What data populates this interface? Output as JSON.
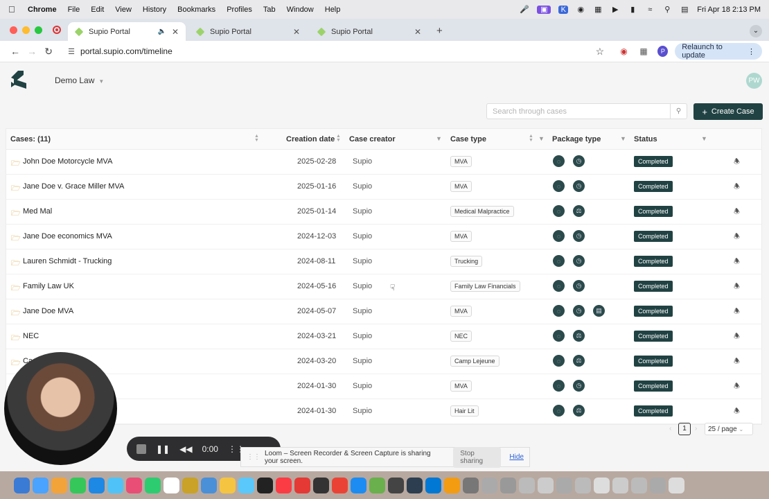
{
  "menubar": {
    "app": "Chrome",
    "items": [
      "File",
      "Edit",
      "View",
      "History",
      "Bookmarks",
      "Profiles",
      "Tab",
      "Window",
      "Help"
    ],
    "clock": "Fri Apr 18  2:13 PM"
  },
  "browser": {
    "tabs": [
      {
        "title": "Supio Portal",
        "active": true
      },
      {
        "title": "Supio Portal",
        "active": false
      },
      {
        "title": "Supio Portal",
        "active": false
      }
    ],
    "url": "portal.supio.com/timeline",
    "relaunch_label": "Relaunch to update",
    "profile_initial": "P"
  },
  "app": {
    "org_name": "Demo Law",
    "user_initials": "PW",
    "search_placeholder": "Search through cases",
    "create_case_label": "Create Case",
    "columns": {
      "cases": "Cases: (11)",
      "creation_date": "Creation date",
      "case_creator": "Case creator",
      "case_type": "Case type",
      "package_type": "Package type",
      "status": "Status"
    },
    "rows": [
      {
        "name": "John Doe Motorcycle MVA",
        "date": "2025-02-28",
        "creator": "Supio",
        "type": "MVA",
        "packages": [
          "chat",
          "clock"
        ],
        "status": "Completed"
      },
      {
        "name": "Jane Doe v. Grace Miller MVA",
        "date": "2025-01-16",
        "creator": "Supio",
        "type": "MVA",
        "packages": [
          "chat",
          "clock"
        ],
        "status": "Completed"
      },
      {
        "name": "Med Mal",
        "date": "2025-01-14",
        "creator": "Supio",
        "type": "Medical Malpractice",
        "packages": [
          "chat",
          "scale"
        ],
        "status": "Completed"
      },
      {
        "name": "Jane Doe economics MVA",
        "date": "2024-12-03",
        "creator": "Supio",
        "type": "MVA",
        "packages": [
          "chat",
          "clock"
        ],
        "status": "Completed"
      },
      {
        "name": "Lauren Schmidt - Trucking",
        "date": "2024-08-11",
        "creator": "Supio",
        "type": "Trucking",
        "packages": [
          "chat",
          "clock"
        ],
        "status": "Completed"
      },
      {
        "name": "Family Law UK",
        "date": "2024-05-16",
        "creator": "Supio",
        "type": "Family Law Financials",
        "packages": [
          "chat",
          "clock"
        ],
        "status": "Completed"
      },
      {
        "name": "Jane Doe MVA",
        "date": "2024-05-07",
        "creator": "Supio",
        "type": "MVA",
        "packages": [
          "chat",
          "clock",
          "document"
        ],
        "status": "Completed"
      },
      {
        "name": "NEC",
        "date": "2024-03-21",
        "creator": "Supio",
        "type": "NEC",
        "packages": [
          "chat",
          "scale"
        ],
        "status": "Completed"
      },
      {
        "name": "Ca",
        "date": "2024-03-20",
        "creator": "Supio",
        "type": "Camp Lejeune",
        "packages": [
          "chat",
          "scale"
        ],
        "status": "Completed"
      },
      {
        "name": "",
        "date": "2024-01-30",
        "creator": "Supio",
        "type": "MVA",
        "packages": [
          "chat",
          "clock"
        ],
        "status": "Completed"
      },
      {
        "name": "",
        "date": "2024-01-30",
        "creator": "Supio",
        "type": "Hair Lit",
        "packages": [
          "chat",
          "scale"
        ],
        "status": "Completed"
      }
    ],
    "pagination": {
      "current_page": "1",
      "page_size": "25 / page"
    }
  },
  "overlays": {
    "loom_time": "0:00",
    "share_message": "Loom – Screen Recorder & Screen Capture is sharing your screen.",
    "stop_sharing_label": "Stop sharing",
    "hide_label": "Hide"
  },
  "colors": {
    "primary": "#214243",
    "status_completed": "#214243",
    "folder": "#d9a441"
  }
}
